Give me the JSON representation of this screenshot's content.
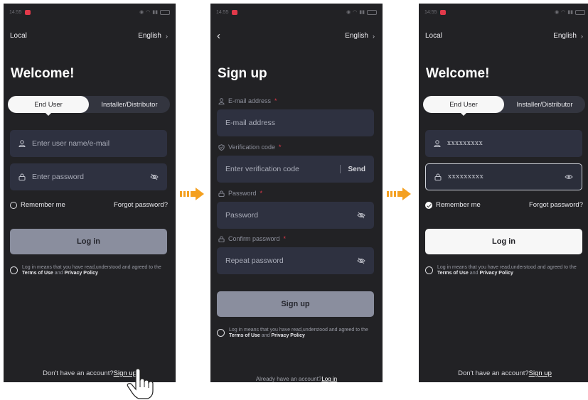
{
  "status": {
    "time": "14:55"
  },
  "screen1": {
    "region_label": "Local",
    "language": "English",
    "title": "Welcome!",
    "tabs": [
      "End User",
      "Installer/Distributor"
    ],
    "username_placeholder": "Enter user name/e-mail",
    "password_placeholder": "Enter password",
    "remember": "Remember me",
    "forgot": "Forgot password?",
    "login": "Log in",
    "terms_prefix": "Log in means that you have read,understood and agreed to the",
    "terms_of_use": "Terms of Use",
    "terms_and": "and",
    "privacy": "Privacy Policy",
    "no_account": "Don't have an account?",
    "signup_link": "Sign up"
  },
  "screen2": {
    "language": "English",
    "title": "Sign up",
    "email_label": "E-mail address",
    "email_placeholder": "E-mail address",
    "code_label": "Verification code",
    "code_placeholder": "Enter verification code",
    "send": "Send",
    "password_label": "Password",
    "password_placeholder": "Password",
    "confirm_label": "Confirm password",
    "confirm_placeholder": "Repeat password",
    "signup": "Sign up",
    "terms_prefix": "Log in means that you have read,understood and agreed to the",
    "terms_of_use": "Terms of Use",
    "terms_and": "and",
    "privacy": "Privacy Policy",
    "have_account": "Already have an account?",
    "login_link": "Log in",
    "required_mark": "*"
  },
  "screen3": {
    "region_label": "Local",
    "language": "English",
    "title": "Welcome!",
    "tabs": [
      "End User",
      "Installer/Distributor"
    ],
    "username_value": "xxxxxxxxx",
    "password_value": "xxxxxxxxx",
    "remember": "Remember me",
    "remember_checked": true,
    "forgot": "Forgot password?",
    "login": "Log in",
    "terms_prefix": "Log in means that you have read,understood and agreed to the",
    "terms_of_use": "Terms of Use",
    "terms_and": "and",
    "privacy": "Privacy Policy",
    "no_account": "Don't have an account?",
    "signup_link": "Sign up"
  },
  "colors": {
    "screen_bg": "#222225",
    "field_bg": "#2e3140",
    "arrow": "#f4a020",
    "required": "#e2394a"
  }
}
